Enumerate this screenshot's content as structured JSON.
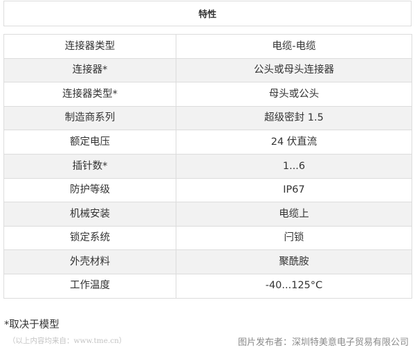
{
  "header": {
    "title": "特性"
  },
  "table": {
    "rows": [
      [
        "连接器类型",
        "电缆-电缆"
      ],
      [
        "连接器*",
        "公头或母头连接器"
      ],
      [
        "连接器类型*",
        "母头或公头"
      ],
      [
        "制造商系列",
        "超级密封 1.5"
      ],
      [
        "额定电压",
        "24 伏直流"
      ],
      [
        "插针数*",
        "1...6"
      ],
      [
        "防护等级",
        "IP67"
      ],
      [
        "机械安装",
        "电缆上"
      ],
      [
        "锁定系统",
        "闩锁"
      ],
      [
        "外壳材料",
        "聚酰胺"
      ],
      [
        "工作温度",
        "-40...125°C"
      ]
    ]
  },
  "footnote": "*取决于模型",
  "source_note": "（以上内容均来自：www.tme.cn）",
  "credit": "图片发布者：深圳特美意电子贸易有限公司"
}
